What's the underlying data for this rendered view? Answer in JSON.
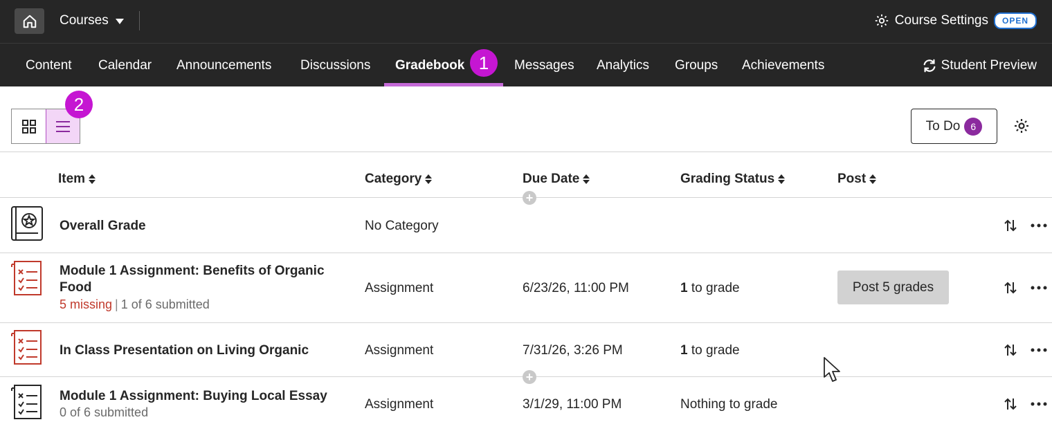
{
  "header": {
    "courses_label": "Courses",
    "course_settings_label": "Course Settings",
    "open_badge": "OPEN"
  },
  "nav": {
    "items": [
      "Content",
      "Calendar",
      "Announcements",
      "Discussions",
      "Gradebook",
      "Messages",
      "Analytics",
      "Groups",
      "Achievements"
    ],
    "active": "Gradebook",
    "student_preview": "Student Preview"
  },
  "steps": [
    "1",
    "2"
  ],
  "toolbar": {
    "todo_label": "To Do",
    "todo_count": "6"
  },
  "table": {
    "headers": [
      "Item",
      "Category",
      "Due Date",
      "Grading Status",
      "Post"
    ],
    "rows": [
      {
        "title": "Overall Grade",
        "category": "No Category",
        "due": "",
        "status_num": "",
        "status_text": "",
        "icon": "overall-grade-icon"
      },
      {
        "title_line1": "Module 1 Assignment: Benefits of Organic",
        "title_line2": "Food",
        "missing": "5 missing",
        "submitted": "1 of 6 submitted",
        "category": "Assignment",
        "due": "6/23/26, 11:00 PM",
        "status_num": "1",
        "status_text": "to grade",
        "post_label": "Post 5 grades",
        "icon": "assignment-icon"
      },
      {
        "title": "In Class Presentation on Living Organic",
        "category": "Assignment",
        "due": "7/31/26, 3:26 PM",
        "status_num": "1",
        "status_text": "to grade",
        "icon": "assignment-icon"
      },
      {
        "title": "Module 1 Assignment: Buying Local Essay",
        "submitted": "0 of 6 submitted",
        "category": "Assignment",
        "due": "3/1/29, 11:00 PM",
        "status_text": "Nothing to grade",
        "icon": "assignment-icon"
      }
    ]
  },
  "colors": {
    "topbar_bg": "#262626",
    "accent": "#c516d2",
    "missing": "#c0392b",
    "open_badge": "#1f6fd1"
  }
}
